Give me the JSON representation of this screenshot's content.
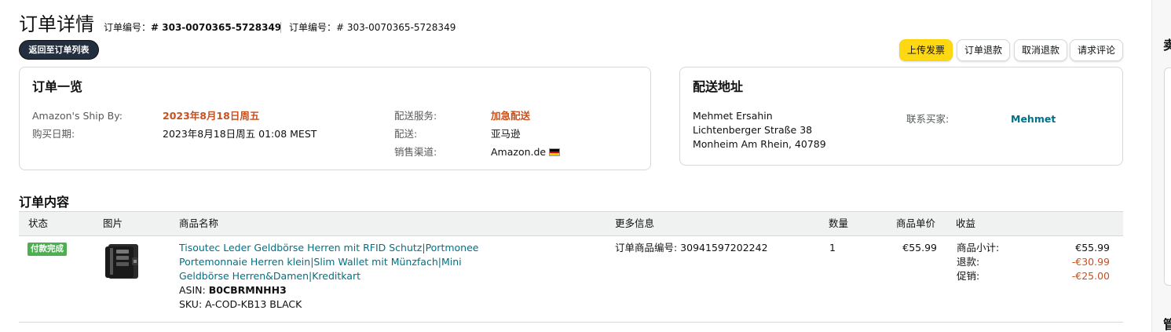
{
  "header": {
    "title": "订单详情",
    "order_label_1": "订单编号：",
    "order_number_1": "# 303-0070365-5728349",
    "order_label_2": "订单编号：",
    "order_number_2": "# 303-0070365-5728349"
  },
  "nav": {
    "back_label": "返回至订单列表"
  },
  "actions": {
    "upload_invoice": "上传发票",
    "refund": "订单退款",
    "cancel_refund": "取消退款",
    "request_review": "请求评论"
  },
  "summary": {
    "title": "订单一览",
    "ship_by_label": "Amazon's Ship By:",
    "ship_by_value": "2023年8月18日周五",
    "purchase_date_label": "购买日期:",
    "purchase_date_value": "2023年8月18日周五 01:08 MEST",
    "ship_service_label": "配送服务:",
    "ship_service_value": "加急配送",
    "fulfillment_label": "配送:",
    "fulfillment_value": "亚马逊",
    "channel_label": "销售渠道:",
    "channel_value": "Amazon.de"
  },
  "address": {
    "title": "配送地址",
    "name": "Mehmet Ersahin",
    "street": "Lichtenberger Straße 38",
    "city": "Monheim Am Rhein, 40789",
    "contact_label": "联系买家:",
    "contact_value": "Mehmet"
  },
  "contents": {
    "title": "订单内容",
    "columns": {
      "status": "状态",
      "image": "图片",
      "product_name": "商品名称",
      "more_info": "更多信息",
      "quantity": "数量",
      "unit_price": "商品单价",
      "proceeds": "收益"
    },
    "item": {
      "status": "付款完成",
      "title": "Tisoutec Leder Geldbörse Herren mit RFID Schutz|Portmonee Portemonnaie Herren klein|Slim Wallet mit Münzfach|Mini Geldbörse Herren&Damen|Kreditkart",
      "asin_label": "ASIN: ",
      "asin": "B0CBRMNHH3",
      "sku": "SKU: A-COD-KB13 BLACK",
      "order_item_id": "订单商品编号: 30941597202242",
      "quantity": "1",
      "unit_price": "€55.99",
      "subtotal_label": "商品小计:",
      "subtotal": "€55.99",
      "refund_label": "退款:",
      "refund": "-€30.99",
      "promo_label": "促销:",
      "promo": "-€25.00"
    }
  },
  "side": {
    "char_1": "卖",
    "char_2": "管"
  },
  "colors": {
    "primary_button": "#ffd814",
    "link": "#007185",
    "warning": "#c7511f",
    "status_green": "#4caf50",
    "header_bg": "#f0f2f2"
  }
}
